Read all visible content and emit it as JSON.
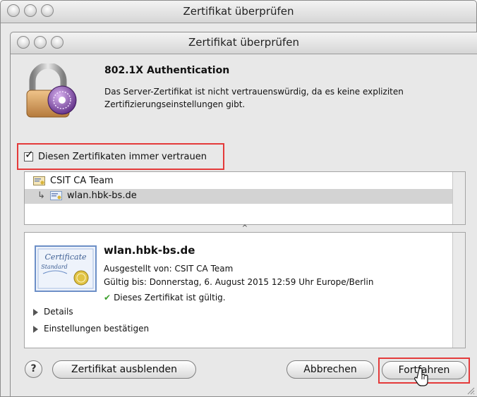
{
  "back_window": {
    "title": "Zertifikat überprüfen"
  },
  "dialog": {
    "title": "Zertifikat überprüfen",
    "heading": "802.1X Authentication",
    "description": "Das Server-Zertifikat ist nicht vertrauenswürdig, da es keine expliziten Zertifizierungseinstellungen gibt.",
    "trust_checkbox": {
      "label": "Diesen Zertifikaten immer vertrauen",
      "checked": true
    }
  },
  "chain": {
    "items": [
      {
        "label": "CSIT CA Team"
      },
      {
        "label": "wlan.hbk-bs.de"
      }
    ],
    "selected_index": 1
  },
  "certificate": {
    "name": "wlan.hbk-bs.de",
    "issued_by": "Ausgestellt von: CSIT CA Team",
    "valid_until": "Gültig bis: Donnerstag, 6. August 2015 12:59 Uhr Europe/Berlin",
    "status": "Dieses Zertifikat ist gültig.",
    "image_text_1": "Certificate",
    "image_text_2": "Standard",
    "disclosures": [
      {
        "label": "Details"
      },
      {
        "label": "Einstellungen bestätigen"
      }
    ]
  },
  "buttons": {
    "help": "?",
    "hide_certificate": "Zertifikat ausblenden",
    "cancel": "Abbrechen",
    "continue": "Fortfahren"
  },
  "icons": {
    "lock": "lock-certificate-icon",
    "cert_small": "certificate-icon",
    "check": "check-circle-icon"
  },
  "colors": {
    "highlight_outline": "#e43a3a",
    "valid_green": "#3a9f2a",
    "selection": "#d3d3d3"
  }
}
